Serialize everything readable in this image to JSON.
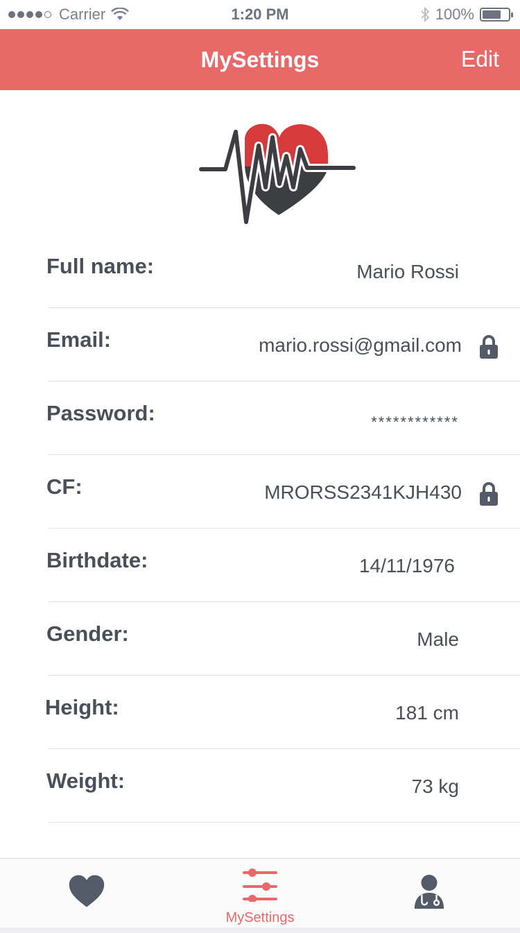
{
  "status_bar": {
    "carrier": "Carrier",
    "time": "1:20 PM",
    "battery": "100%"
  },
  "nav": {
    "title": "MySettings",
    "edit_label": "Edit"
  },
  "logo": {
    "icon": "heartbeat-heart-logo",
    "colors": {
      "red": "#d63a3a",
      "dark": "#3d3e42"
    }
  },
  "profile": {
    "rows": [
      {
        "label": "Full name:",
        "value": "Mario Rossi",
        "locked": false
      },
      {
        "label": "Email:",
        "value": "mario.rossi@gmail.com",
        "locked": true
      },
      {
        "label": "Password:",
        "value": "************",
        "locked": false
      },
      {
        "label": "CF:",
        "value": "MRORSS2341KJH430",
        "locked": true
      },
      {
        "label": "Birthdate:",
        "value": "14/11/1976",
        "locked": false
      },
      {
        "label": "Gender:",
        "value": "Male",
        "locked": false
      },
      {
        "label": "Height:",
        "value": "181 cm",
        "locked": false
      },
      {
        "label": "Weight:",
        "value": "73 kg",
        "locked": false
      }
    ]
  },
  "tabs": [
    {
      "icon": "heart-icon",
      "label": ""
    },
    {
      "icon": "sliders-icon",
      "label": "MySettings",
      "active": true
    },
    {
      "icon": "doctor-icon",
      "label": ""
    }
  ],
  "colors": {
    "accent": "#e96969",
    "text": "#4a4f5a",
    "icon_gray": "#545b68"
  }
}
